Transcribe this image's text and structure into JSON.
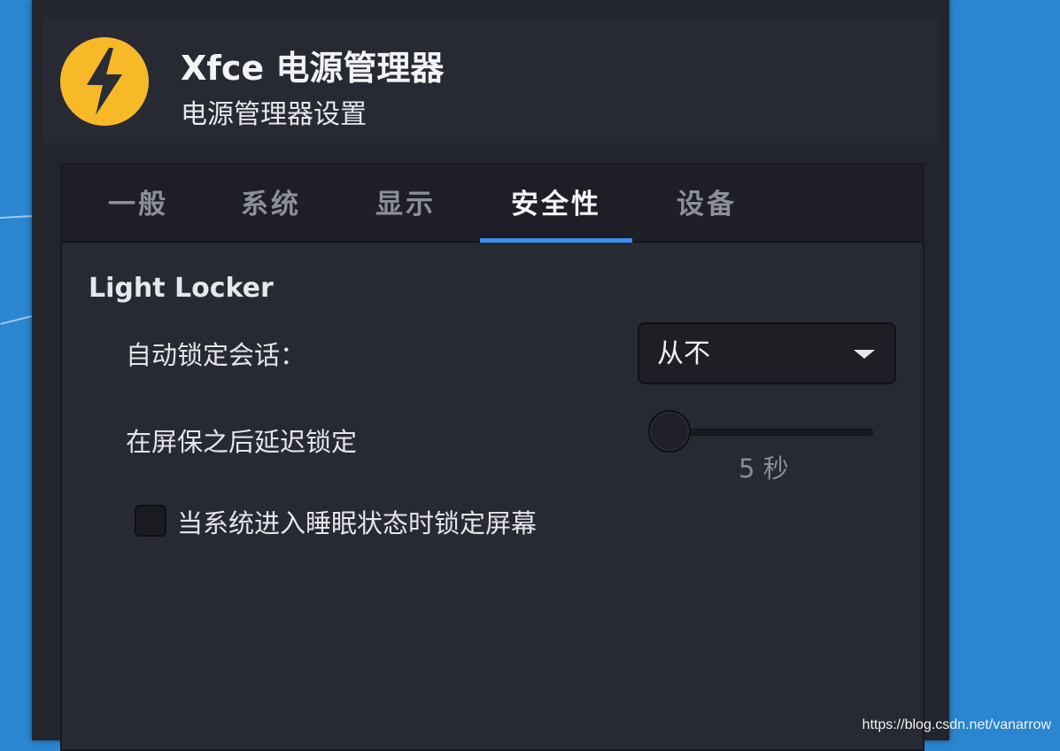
{
  "header": {
    "title": "Xfce 电源管理器",
    "subtitle": "电源管理器设置",
    "icon": "lightning-bolt-icon",
    "icon_color": "#f7b928"
  },
  "tabs": [
    {
      "label": "一般",
      "active": false
    },
    {
      "label": "系统",
      "active": false
    },
    {
      "label": "显示",
      "active": false
    },
    {
      "label": "安全性",
      "active": true
    },
    {
      "label": "设备",
      "active": false
    }
  ],
  "accent_color": "#3b8ced",
  "security": {
    "section_title": "Light Locker",
    "auto_lock_label": "自动锁定会话：",
    "auto_lock_value": "从不",
    "delay_label": "在屏保之后延迟锁定",
    "delay_value_text": "5 秒",
    "delay_slider_position": 0,
    "lock_on_sleep_label": "当系统进入睡眠状态时锁定屏幕",
    "lock_on_sleep_checked": false
  },
  "watermark": "https://blog.csdn.net/vanarrow"
}
